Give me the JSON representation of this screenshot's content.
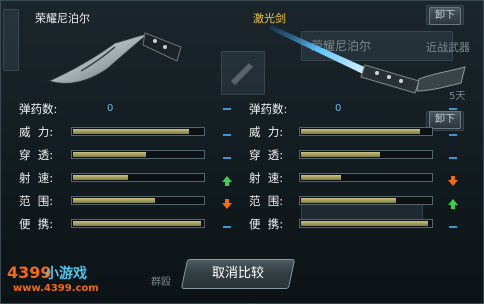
{
  "left": {
    "weapon_name": "荣耀尼泊尔",
    "ammo_label": "弹药数:",
    "ammo_value": "0",
    "stats": [
      {
        "label": "威  力:",
        "fill": 0.88,
        "indicator": "equal"
      },
      {
        "label": "穿  透:",
        "fill": 0.55,
        "indicator": "equal"
      },
      {
        "label": "射  速:",
        "fill": 0.42,
        "indicator": "up"
      },
      {
        "label": "范  围:",
        "fill": 0.62,
        "indicator": "down"
      },
      {
        "label": "便  携:",
        "fill": 0.97,
        "indicator": "equal"
      }
    ]
  },
  "right": {
    "weapon_name": "激光剑",
    "ammo_label": "弹药数:",
    "ammo_value": "0",
    "stats": [
      {
        "label": "威  力:",
        "fill": 0.9,
        "indicator": "equal"
      },
      {
        "label": "穿  透:",
        "fill": 0.6,
        "indicator": "equal"
      },
      {
        "label": "射  速:",
        "fill": 0.3,
        "indicator": "down"
      },
      {
        "label": "范  围:",
        "fill": 0.72,
        "indicator": "up"
      },
      {
        "label": "便  携:",
        "fill": 0.96,
        "indicator": "equal"
      }
    ]
  },
  "background": {
    "unload_label_top": "卸下",
    "unload_label_mid": "卸下",
    "bg_weapon_name": "荣耀尼泊尔",
    "bg_category": "近战武器",
    "bg_days": "5天",
    "bg_text_bottom": "群殴"
  },
  "cancel_label": "取消比较",
  "watermark": {
    "brand_num": "4399",
    "brand_text": "小游戏",
    "url": "www.4399.com"
  },
  "colors": {
    "bar_fill": "#b5b070",
    "indicator_up": "#3ccf4e",
    "indicator_down": "#f06a1c",
    "indicator_equal": "#3f97d0",
    "ammo_value": "#6fb9e8",
    "laser_name": "#f2c542"
  }
}
